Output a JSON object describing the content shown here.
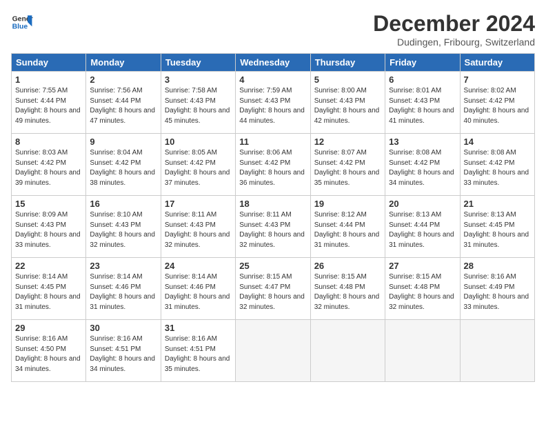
{
  "header": {
    "logo_line1": "General",
    "logo_line2": "Blue",
    "month": "December 2024",
    "location": "Dudingen, Fribourg, Switzerland"
  },
  "weekdays": [
    "Sunday",
    "Monday",
    "Tuesday",
    "Wednesday",
    "Thursday",
    "Friday",
    "Saturday"
  ],
  "weeks": [
    [
      {
        "day": "1",
        "sunrise": "7:55 AM",
        "sunset": "4:44 PM",
        "daylight": "8 hours and 49 minutes."
      },
      {
        "day": "2",
        "sunrise": "7:56 AM",
        "sunset": "4:44 PM",
        "daylight": "8 hours and 47 minutes."
      },
      {
        "day": "3",
        "sunrise": "7:58 AM",
        "sunset": "4:43 PM",
        "daylight": "8 hours and 45 minutes."
      },
      {
        "day": "4",
        "sunrise": "7:59 AM",
        "sunset": "4:43 PM",
        "daylight": "8 hours and 44 minutes."
      },
      {
        "day": "5",
        "sunrise": "8:00 AM",
        "sunset": "4:43 PM",
        "daylight": "8 hours and 42 minutes."
      },
      {
        "day": "6",
        "sunrise": "8:01 AM",
        "sunset": "4:43 PM",
        "daylight": "8 hours and 41 minutes."
      },
      {
        "day": "7",
        "sunrise": "8:02 AM",
        "sunset": "4:42 PM",
        "daylight": "8 hours and 40 minutes."
      }
    ],
    [
      {
        "day": "8",
        "sunrise": "8:03 AM",
        "sunset": "4:42 PM",
        "daylight": "8 hours and 39 minutes."
      },
      {
        "day": "9",
        "sunrise": "8:04 AM",
        "sunset": "4:42 PM",
        "daylight": "8 hours and 38 minutes."
      },
      {
        "day": "10",
        "sunrise": "8:05 AM",
        "sunset": "4:42 PM",
        "daylight": "8 hours and 37 minutes."
      },
      {
        "day": "11",
        "sunrise": "8:06 AM",
        "sunset": "4:42 PM",
        "daylight": "8 hours and 36 minutes."
      },
      {
        "day": "12",
        "sunrise": "8:07 AM",
        "sunset": "4:42 PM",
        "daylight": "8 hours and 35 minutes."
      },
      {
        "day": "13",
        "sunrise": "8:08 AM",
        "sunset": "4:42 PM",
        "daylight": "8 hours and 34 minutes."
      },
      {
        "day": "14",
        "sunrise": "8:08 AM",
        "sunset": "4:42 PM",
        "daylight": "8 hours and 33 minutes."
      }
    ],
    [
      {
        "day": "15",
        "sunrise": "8:09 AM",
        "sunset": "4:43 PM",
        "daylight": "8 hours and 33 minutes."
      },
      {
        "day": "16",
        "sunrise": "8:10 AM",
        "sunset": "4:43 PM",
        "daylight": "8 hours and 32 minutes."
      },
      {
        "day": "17",
        "sunrise": "8:11 AM",
        "sunset": "4:43 PM",
        "daylight": "8 hours and 32 minutes."
      },
      {
        "day": "18",
        "sunrise": "8:11 AM",
        "sunset": "4:43 PM",
        "daylight": "8 hours and 32 minutes."
      },
      {
        "day": "19",
        "sunrise": "8:12 AM",
        "sunset": "4:44 PM",
        "daylight": "8 hours and 31 minutes."
      },
      {
        "day": "20",
        "sunrise": "8:13 AM",
        "sunset": "4:44 PM",
        "daylight": "8 hours and 31 minutes."
      },
      {
        "day": "21",
        "sunrise": "8:13 AM",
        "sunset": "4:45 PM",
        "daylight": "8 hours and 31 minutes."
      }
    ],
    [
      {
        "day": "22",
        "sunrise": "8:14 AM",
        "sunset": "4:45 PM",
        "daylight": "8 hours and 31 minutes."
      },
      {
        "day": "23",
        "sunrise": "8:14 AM",
        "sunset": "4:46 PM",
        "daylight": "8 hours and 31 minutes."
      },
      {
        "day": "24",
        "sunrise": "8:14 AM",
        "sunset": "4:46 PM",
        "daylight": "8 hours and 31 minutes."
      },
      {
        "day": "25",
        "sunrise": "8:15 AM",
        "sunset": "4:47 PM",
        "daylight": "8 hours and 32 minutes."
      },
      {
        "day": "26",
        "sunrise": "8:15 AM",
        "sunset": "4:48 PM",
        "daylight": "8 hours and 32 minutes."
      },
      {
        "day": "27",
        "sunrise": "8:15 AM",
        "sunset": "4:48 PM",
        "daylight": "8 hours and 32 minutes."
      },
      {
        "day": "28",
        "sunrise": "8:16 AM",
        "sunset": "4:49 PM",
        "daylight": "8 hours and 33 minutes."
      }
    ],
    [
      {
        "day": "29",
        "sunrise": "8:16 AM",
        "sunset": "4:50 PM",
        "daylight": "8 hours and 34 minutes."
      },
      {
        "day": "30",
        "sunrise": "8:16 AM",
        "sunset": "4:51 PM",
        "daylight": "8 hours and 34 minutes."
      },
      {
        "day": "31",
        "sunrise": "8:16 AM",
        "sunset": "4:51 PM",
        "daylight": "8 hours and 35 minutes."
      },
      null,
      null,
      null,
      null
    ]
  ],
  "labels": {
    "sunrise": "Sunrise:",
    "sunset": "Sunset:",
    "daylight": "Daylight:"
  }
}
